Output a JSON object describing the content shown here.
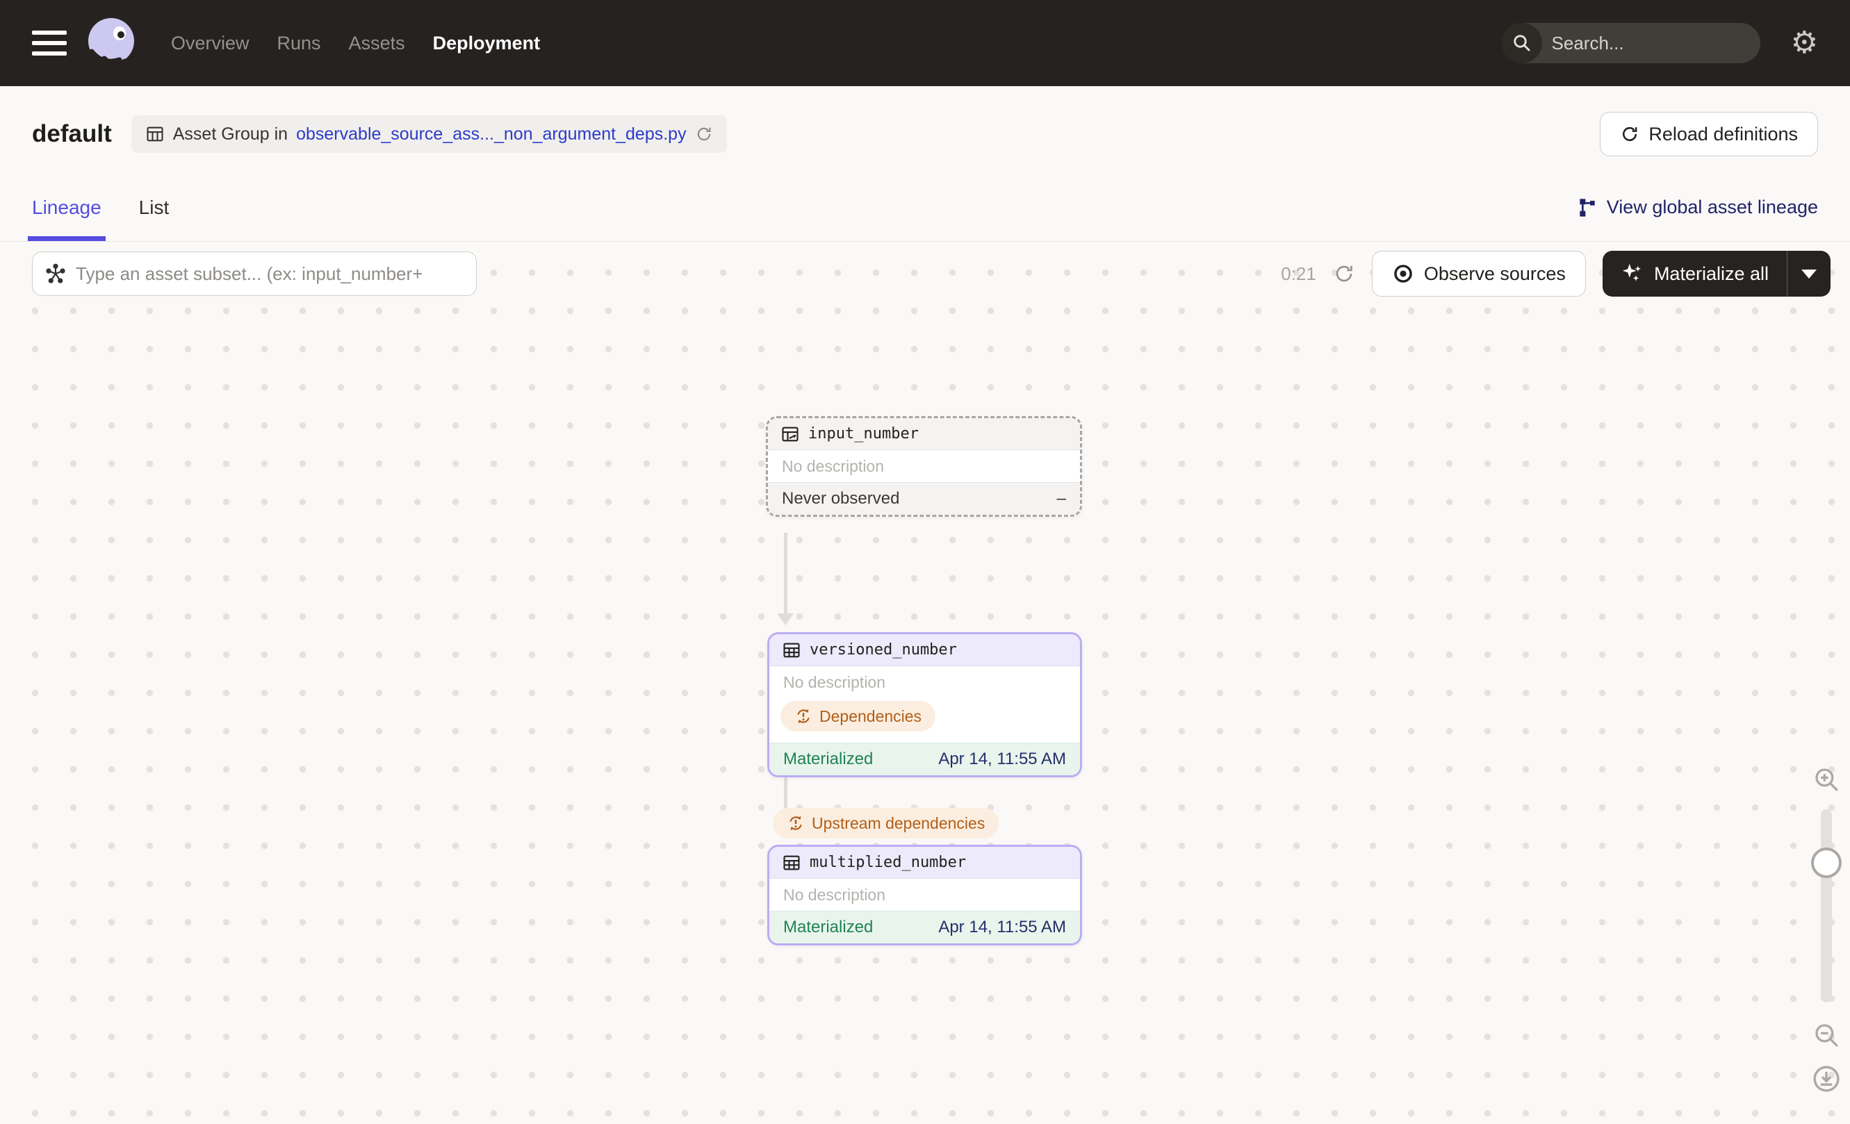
{
  "topnav": {
    "items": [
      {
        "label": "Overview",
        "active": false
      },
      {
        "label": "Runs",
        "active": false
      },
      {
        "label": "Assets",
        "active": false
      },
      {
        "label": "Deployment",
        "active": true
      }
    ],
    "search_placeholder": "Search...",
    "search_shortcut": "/",
    "gear_glyph": "⚙"
  },
  "header": {
    "title": "default",
    "badge_prefix": "Asset Group in",
    "badge_link": "observable_source_ass..._non_argument_deps.py",
    "reload_button": "Reload definitions"
  },
  "tabs": {
    "lineage": "Lineage",
    "list": "List",
    "global_link": "View global asset lineage"
  },
  "toolbar": {
    "filter_placeholder": "Type an asset subset... (ex: input_number+",
    "timer": "0:21",
    "observe_button": "Observe sources",
    "materialize_button": "Materialize all"
  },
  "graph": {
    "edge_tag": "Upstream dependencies",
    "nodes": [
      {
        "name": "input_number",
        "description": "No description",
        "status_label": "Never observed",
        "status_value": "–"
      },
      {
        "name": "versioned_number",
        "description": "No description",
        "tag": "Dependencies",
        "status_label": "Materialized",
        "status_value": "Apr 14, 11:55 AM"
      },
      {
        "name": "multiplied_number",
        "description": "No description",
        "status_label": "Materialized",
        "status_value": "Apr 14, 11:55 AM"
      }
    ]
  },
  "colors": {
    "accent_blurple": "#554CE0",
    "link_blue": "#2C3BC9",
    "navy_link": "#212369",
    "status_green": "#1F8453",
    "status_navy": "#23306B",
    "tag_orange": "#B25E17",
    "node_purple_border": "#BCACF3",
    "navbar_bg": "#262220"
  }
}
